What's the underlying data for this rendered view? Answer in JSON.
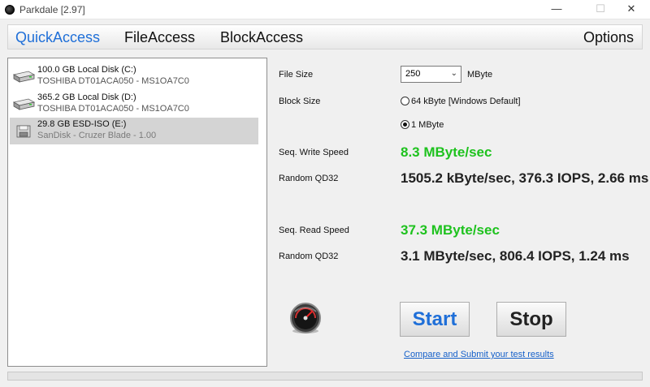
{
  "window": {
    "title": "Parkdale [2.97]",
    "minimize": "—",
    "maximize": "☐",
    "close": "✕"
  },
  "tabs": {
    "quick": "QuickAccess",
    "file": "FileAccess",
    "block": "BlockAccess",
    "options": "Options",
    "active": "QuickAccess"
  },
  "drives": [
    {
      "name": "100.0 GB Local Disk (C:)",
      "detail": "TOSHIBA DT01ACA050 - MS1OA7C0",
      "icon": "hard-disk-icon"
    },
    {
      "name": "365.2 GB Local Disk (D:)",
      "detail": "TOSHIBA DT01ACA050 - MS1OA7C0",
      "icon": "hard-disk-icon"
    },
    {
      "name": "29.8 GB ESD-ISO (E:)",
      "detail": "SanDisk - Cruzer Blade - 1.00",
      "icon": "usb-drive-icon",
      "selected": true
    }
  ],
  "settings": {
    "file_size_label": "File Size",
    "file_size_value": "250",
    "file_size_unit": "MByte",
    "block_size_label": "Block Size",
    "block_option_1": "64 kByte [Windows Default]",
    "block_option_2": "1 MByte",
    "block_selected": "1 MByte"
  },
  "results": {
    "seq_write_label": "Seq. Write Speed",
    "seq_write_value": "8.3 MByte/sec",
    "random_write_label": "Random QD32",
    "random_write_value": "1505.2 kByte/sec, 376.3 IOPS, 2.66 ms",
    "seq_read_label": "Seq. Read Speed",
    "seq_read_value": "37.3 MByte/sec",
    "random_read_label": "Random QD32",
    "random_read_value": "3.1 MByte/sec, 806.4 IOPS, 1.24 ms"
  },
  "actions": {
    "start_label": "Start",
    "stop_label": "Stop",
    "submit_link": "Compare and Submit your test results"
  },
  "colors": {
    "accent": "#1f6fd8",
    "speed_green": "#1ec21e",
    "selected_row": "#d4d4d4"
  }
}
